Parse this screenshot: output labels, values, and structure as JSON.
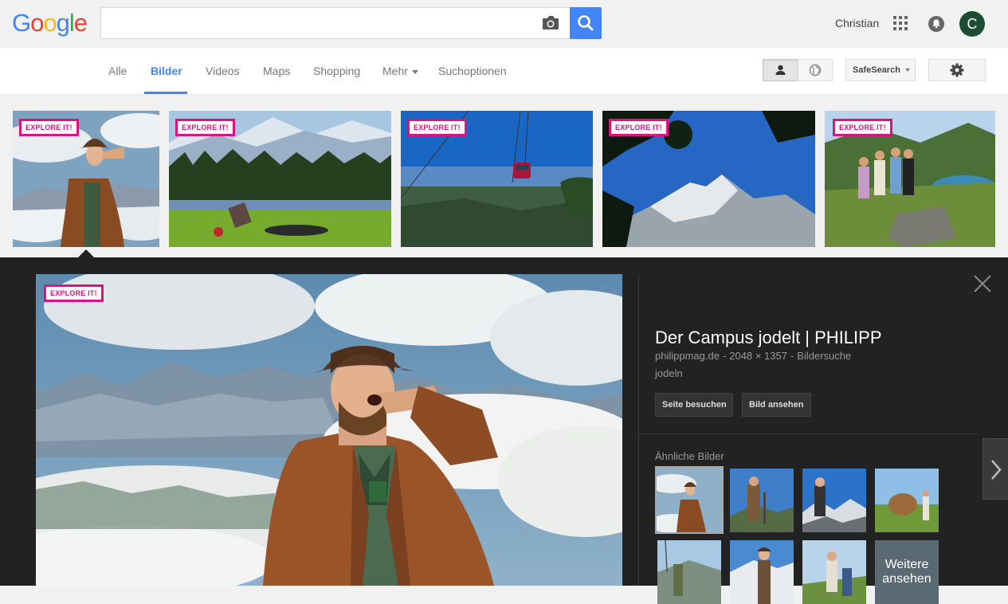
{
  "header": {
    "logo_letters": [
      {
        "char": "G",
        "color": "#4285f4"
      },
      {
        "char": "o",
        "color": "#ea4335"
      },
      {
        "char": "o",
        "color": "#fbbc05"
      },
      {
        "char": "g",
        "color": "#4285f4"
      },
      {
        "char": "l",
        "color": "#34a853"
      },
      {
        "char": "e",
        "color": "#ea4335"
      }
    ],
    "search_value": "",
    "user_name": "Christian",
    "avatar_letter": "C",
    "accent_color": "#4285f4"
  },
  "tabs": [
    {
      "label": "Alle",
      "active": false
    },
    {
      "label": "Bilder",
      "active": true
    },
    {
      "label": "Videos",
      "active": false
    },
    {
      "label": "Maps",
      "active": false
    },
    {
      "label": "Shopping",
      "active": false
    },
    {
      "label": "Mehr",
      "active": false,
      "has_caret": true
    },
    {
      "label": "Suchoptionen",
      "active": false
    }
  ],
  "tools": {
    "safesearch_label": "SafeSearch"
  },
  "results": {
    "badge_label": "EXPLORE IT!",
    "badge_color": "#e0117f",
    "thumbnails": [
      {
        "subject": "yodeling man in tracht above clouds"
      },
      {
        "subject": "person lying on alpine meadow by lake"
      },
      {
        "subject": "red cable car over valley"
      },
      {
        "subject": "mountain summit through foreground leaves"
      },
      {
        "subject": "group of hikers above alpine lake"
      }
    ]
  },
  "preview": {
    "badge_label": "EXPLORE IT!",
    "title": "Der Campus jodelt | PHILIPP",
    "source": "philippmag.de",
    "dimensions": "2048 × 1357",
    "search_link": "Bildersuche",
    "description": "jodeln",
    "visit_button": "Seite besuchen",
    "view_button": "Bild ansehen",
    "similar_label": "Ähnliche Bilder",
    "more_label_line1": "Weitere",
    "more_label_line2": "ansehen"
  }
}
